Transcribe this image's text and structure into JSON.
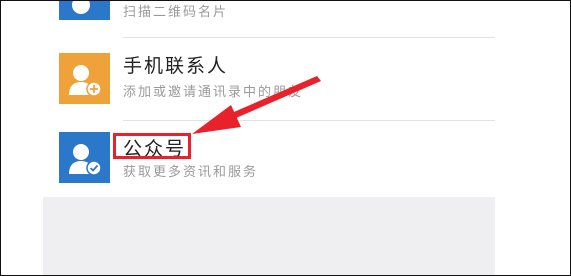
{
  "items": [
    {
      "title": "",
      "subtitle": "扫描二维码名片",
      "icon": "scan-qr-icon",
      "color": "#2b77c9"
    },
    {
      "title": "手机联系人",
      "subtitle": "添加或邀请通讯录中的朋友",
      "icon": "phone-contact-add-icon",
      "color": "#f0a23a"
    },
    {
      "title": "公众号",
      "subtitle": "获取更多资讯和服务",
      "icon": "official-account-icon",
      "color": "#2b77c9"
    }
  ],
  "annotation": {
    "highlight_color": "#e8212b"
  }
}
